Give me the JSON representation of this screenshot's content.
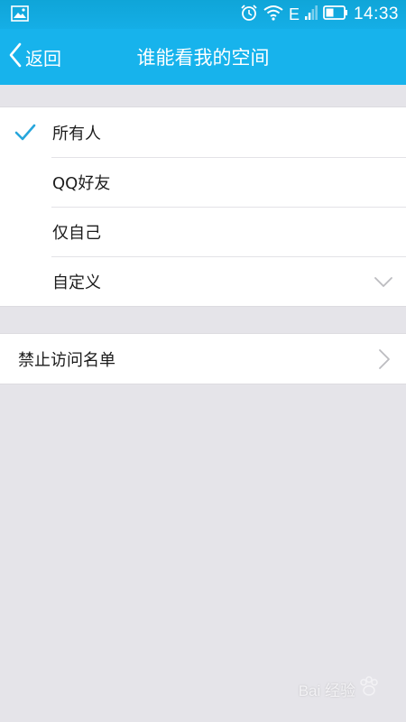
{
  "status_bar": {
    "time": "14:33",
    "network_type": "E",
    "icons": [
      "image-icon",
      "alarm-icon",
      "wifi-icon",
      "signal-icon",
      "battery-icon"
    ]
  },
  "nav": {
    "back_label": "返回",
    "title": "谁能看我的空间"
  },
  "visibility_options": [
    {
      "label": "所有人",
      "selected": true
    },
    {
      "label": "QQ好友",
      "selected": false
    },
    {
      "label": "仅自己",
      "selected": false
    },
    {
      "label": "自定义",
      "selected": false
    }
  ],
  "blocklist": {
    "label": "禁止访问名单"
  },
  "watermark": {
    "text": "Bai 经验"
  },
  "colors": {
    "accent": "#17b3ec",
    "check": "#27a6dc",
    "background": "#e5e4e9"
  }
}
